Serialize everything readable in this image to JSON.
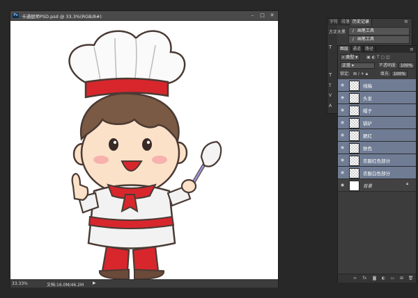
{
  "document": {
    "title": "卡通厨师PSD.psd @ 33.3%(RGB/8#)",
    "ps_badge": "Ps",
    "zoom": "33.33%",
    "doc_info": "文档:16.0M/46.2M"
  },
  "history_panel": {
    "tabs": [
      "字符",
      "段落",
      "历史记录"
    ],
    "font_label": "方正大黑",
    "entries": [
      "画笔工具",
      "画笔工具"
    ]
  },
  "layers_panel": {
    "tabs": [
      "图层",
      "通道",
      "路径"
    ],
    "filter_label": "类型",
    "blend_mode": "正常",
    "opacity_label": "不透明度:",
    "opacity_value": "100%",
    "lock_label": "锁定:",
    "fill_label": "填充:",
    "fill_value": "100%",
    "layers": [
      {
        "name": "线稿"
      },
      {
        "name": "头发"
      },
      {
        "name": "帽子"
      },
      {
        "name": "锅铲"
      },
      {
        "name": "腮红"
      },
      {
        "name": "肤色"
      },
      {
        "name": "衣服红色部分"
      },
      {
        "name": "衣服白色部分"
      },
      {
        "name": "背景"
      }
    ]
  },
  "colors": {
    "chef_red": "#d8262d",
    "skin": "#fbe1c8",
    "hair": "#7a5a44",
    "selected_layer": "#6f7c94"
  }
}
